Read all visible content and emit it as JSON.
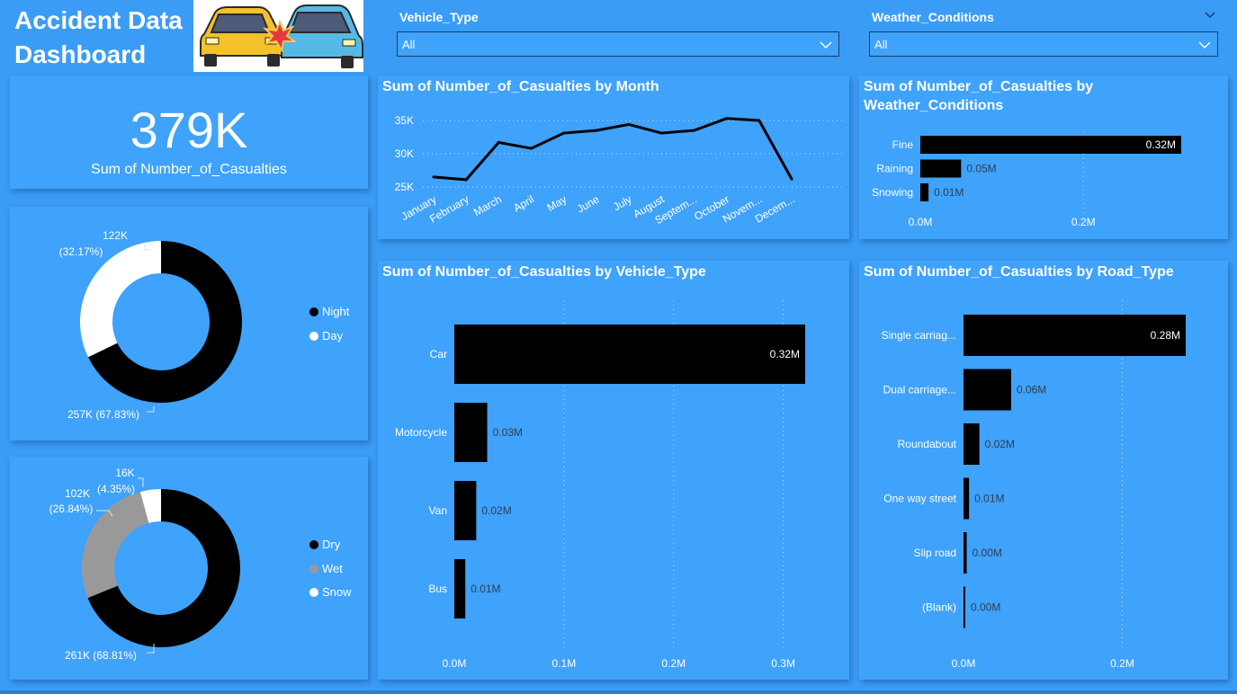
{
  "header": {
    "title_line1": "Accident Data",
    "title_line2": "Dashboard"
  },
  "slicers": {
    "vehicle": {
      "label": "Vehicle_Type",
      "value": "All"
    },
    "weather": {
      "label": "Weather_Conditions",
      "value": "All"
    }
  },
  "kpi": {
    "value": "379K",
    "label": "Sum of Number_of_Casualties"
  },
  "donut_daynight": {
    "legend": [
      {
        "label": "Night",
        "color": "#000000"
      },
      {
        "label": "Day",
        "color": "#ffffff"
      }
    ],
    "labels": {
      "day_value": "122K",
      "day_pct": "(32.17%)",
      "night": "257K (67.83%)"
    }
  },
  "donut_surface": {
    "legend": [
      {
        "label": "Dry",
        "color": "#000000"
      },
      {
        "label": "Wet",
        "color": "#999999"
      },
      {
        "label": "Snow",
        "color": "#ffffff"
      }
    ],
    "labels": {
      "snow_value": "16K",
      "snow_pct": "(4.35%)",
      "wet_value": "102K",
      "wet_pct": "(26.84%)",
      "dry": "261K (68.81%)"
    }
  },
  "titles": {
    "month": "Sum of Number_of_Casualties by Month",
    "weather_line1": "Sum of Number_of_Casualties by",
    "weather_line2": "Weather_Conditions",
    "vehicle": "Sum of Number_of_Casualties by Vehicle_Type",
    "road": "Sum of Number_of_Casualties by Road_Type"
  },
  "chart_data": [
    {
      "type": "line",
      "title": "Sum of Number_of_Casualties by Month",
      "categories": [
        "January",
        "February",
        "March",
        "April",
        "May",
        "June",
        "July",
        "August",
        "Septem...",
        "October",
        "Novem...",
        "Decem..."
      ],
      "values": [
        26500,
        26100,
        31700,
        30800,
        33100,
        33500,
        34400,
        33100,
        33500,
        35300,
        35000,
        26200
      ],
      "ylim": [
        25000,
        35000
      ],
      "yticks": [
        "25K",
        "30K",
        "35K"
      ],
      "grid": true
    },
    {
      "type": "bar",
      "orientation": "horizontal",
      "title": "Sum of Number_of_Casualties by Weather_Conditions",
      "categories": [
        "Fine",
        "Raining",
        "Snowing"
      ],
      "values": [
        0.32,
        0.05,
        0.01
      ],
      "value_labels": [
        "0.32M",
        "0.05M",
        "0.01M"
      ],
      "xlim": [
        0,
        0.32
      ],
      "xticks": [
        "0.0M",
        "0.2M"
      ]
    },
    {
      "type": "bar",
      "orientation": "horizontal",
      "title": "Sum of Number_of_Casualties by Vehicle_Type",
      "categories": [
        "Car",
        "Motorcycle",
        "Van",
        "Bus"
      ],
      "values": [
        0.32,
        0.03,
        0.02,
        0.01
      ],
      "value_labels": [
        "0.32M",
        "0.03M",
        "0.02M",
        "0.01M"
      ],
      "xlim": [
        0,
        0.32
      ],
      "xticks": [
        "0.0M",
        "0.1M",
        "0.2M",
        "0.3M"
      ]
    },
    {
      "type": "bar",
      "orientation": "horizontal",
      "title": "Sum of Number_of_Casualties by Road_Type",
      "categories": [
        "Single carriag...",
        "Dual carriage...",
        "Roundabout",
        "One way street",
        "Slip road",
        "(Blank)"
      ],
      "values": [
        0.28,
        0.06,
        0.02,
        0.007,
        0.004,
        0.001
      ],
      "value_labels": [
        "0.28M",
        "0.06M",
        "0.02M",
        "0.01M",
        "0.00M",
        "0.00M"
      ],
      "xlim": [
        0,
        0.28
      ],
      "xticks": [
        "0.0M",
        "0.2M"
      ]
    },
    {
      "type": "pie",
      "categories": [
        "Night",
        "Day"
      ],
      "values": [
        257,
        122
      ],
      "percents": [
        67.83,
        32.17
      ]
    },
    {
      "type": "pie",
      "categories": [
        "Dry",
        "Wet",
        "Snow"
      ],
      "values": [
        261,
        102,
        16
      ],
      "percents": [
        68.81,
        26.84,
        4.35
      ]
    }
  ]
}
